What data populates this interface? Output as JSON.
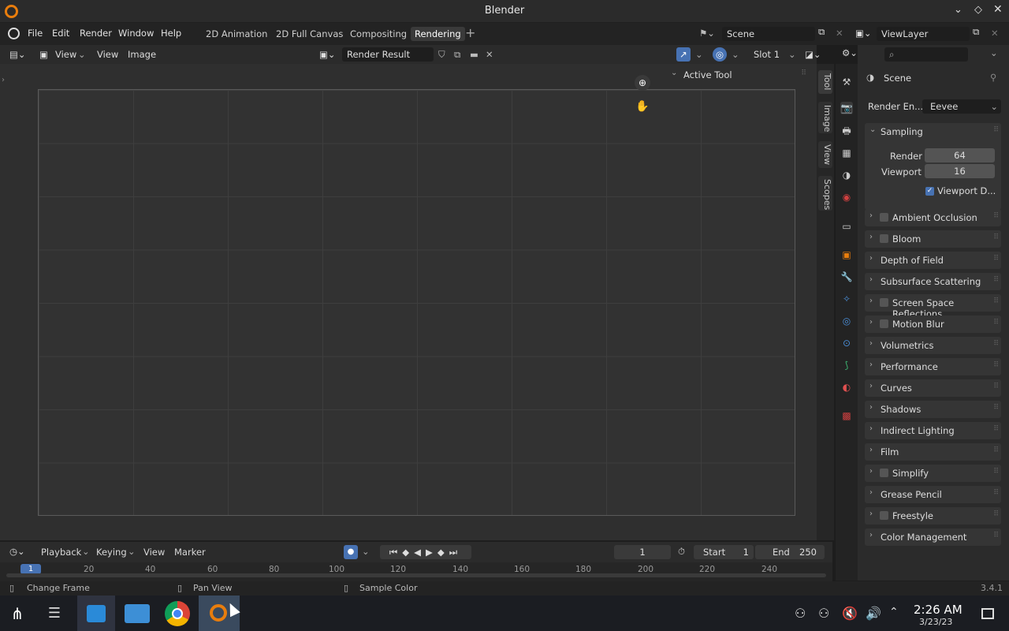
{
  "window": {
    "title": "Blender"
  },
  "menu": {
    "file": "File",
    "edit": "Edit",
    "render": "Render",
    "window": "Window",
    "help": "Help"
  },
  "workspaces": [
    "2D Animation",
    "2D Full Canvas",
    "Compositing",
    "Rendering"
  ],
  "scene": {
    "name": "Scene",
    "view_layer": "ViewLayer"
  },
  "image_editor": {
    "view_menu": "View",
    "view": "View",
    "image": "Image",
    "render_result": "Render Result",
    "slot": "Slot 1",
    "active_tool": "Active Tool",
    "tabs": [
      "Tool",
      "Image",
      "View",
      "Scopes"
    ]
  },
  "properties": {
    "context": "Scene",
    "render_engine_label": "Render En...",
    "render_engine": "Eevee",
    "sampling": {
      "title": "Sampling",
      "render_label": "Render",
      "render_value": "64",
      "viewport_label": "Viewport",
      "viewport_value": "16",
      "denoise_label": "Viewport D..."
    },
    "panels": [
      {
        "label": "Ambient Occlusion",
        "checkbox": true
      },
      {
        "label": "Bloom",
        "checkbox": true
      },
      {
        "label": "Depth of Field",
        "checkbox": false
      },
      {
        "label": "Subsurface Scattering",
        "checkbox": false
      },
      {
        "label": "Screen Space Reflections",
        "checkbox": true
      },
      {
        "label": "Motion Blur",
        "checkbox": true
      },
      {
        "label": "Volumetrics",
        "checkbox": false
      },
      {
        "label": "Performance",
        "checkbox": false
      },
      {
        "label": "Curves",
        "checkbox": false
      },
      {
        "label": "Shadows",
        "checkbox": false
      },
      {
        "label": "Indirect Lighting",
        "checkbox": false
      },
      {
        "label": "Film",
        "checkbox": false
      },
      {
        "label": "Simplify",
        "checkbox": true
      },
      {
        "label": "Grease Pencil",
        "checkbox": false
      },
      {
        "label": "Freestyle",
        "checkbox": true
      },
      {
        "label": "Color Management",
        "checkbox": false
      }
    ]
  },
  "timeline": {
    "playback": "Playback",
    "keying": "Keying",
    "view": "View",
    "marker": "Marker",
    "current_frame": "1",
    "start_label": "Start",
    "start": "1",
    "end_label": "End",
    "end": "250",
    "ticks": [
      "1",
      "20",
      "40",
      "60",
      "80",
      "100",
      "120",
      "140",
      "160",
      "180",
      "200",
      "220",
      "240"
    ]
  },
  "status": {
    "change_frame": "Change Frame",
    "pan_view": "Pan View",
    "sample_color": "Sample Color",
    "version": "3.4.1"
  },
  "taskbar": {
    "time": "2:26 AM",
    "date": "3/23/23"
  },
  "colors": {
    "accent": "#4772b3",
    "bg": "#2b2b2b"
  }
}
